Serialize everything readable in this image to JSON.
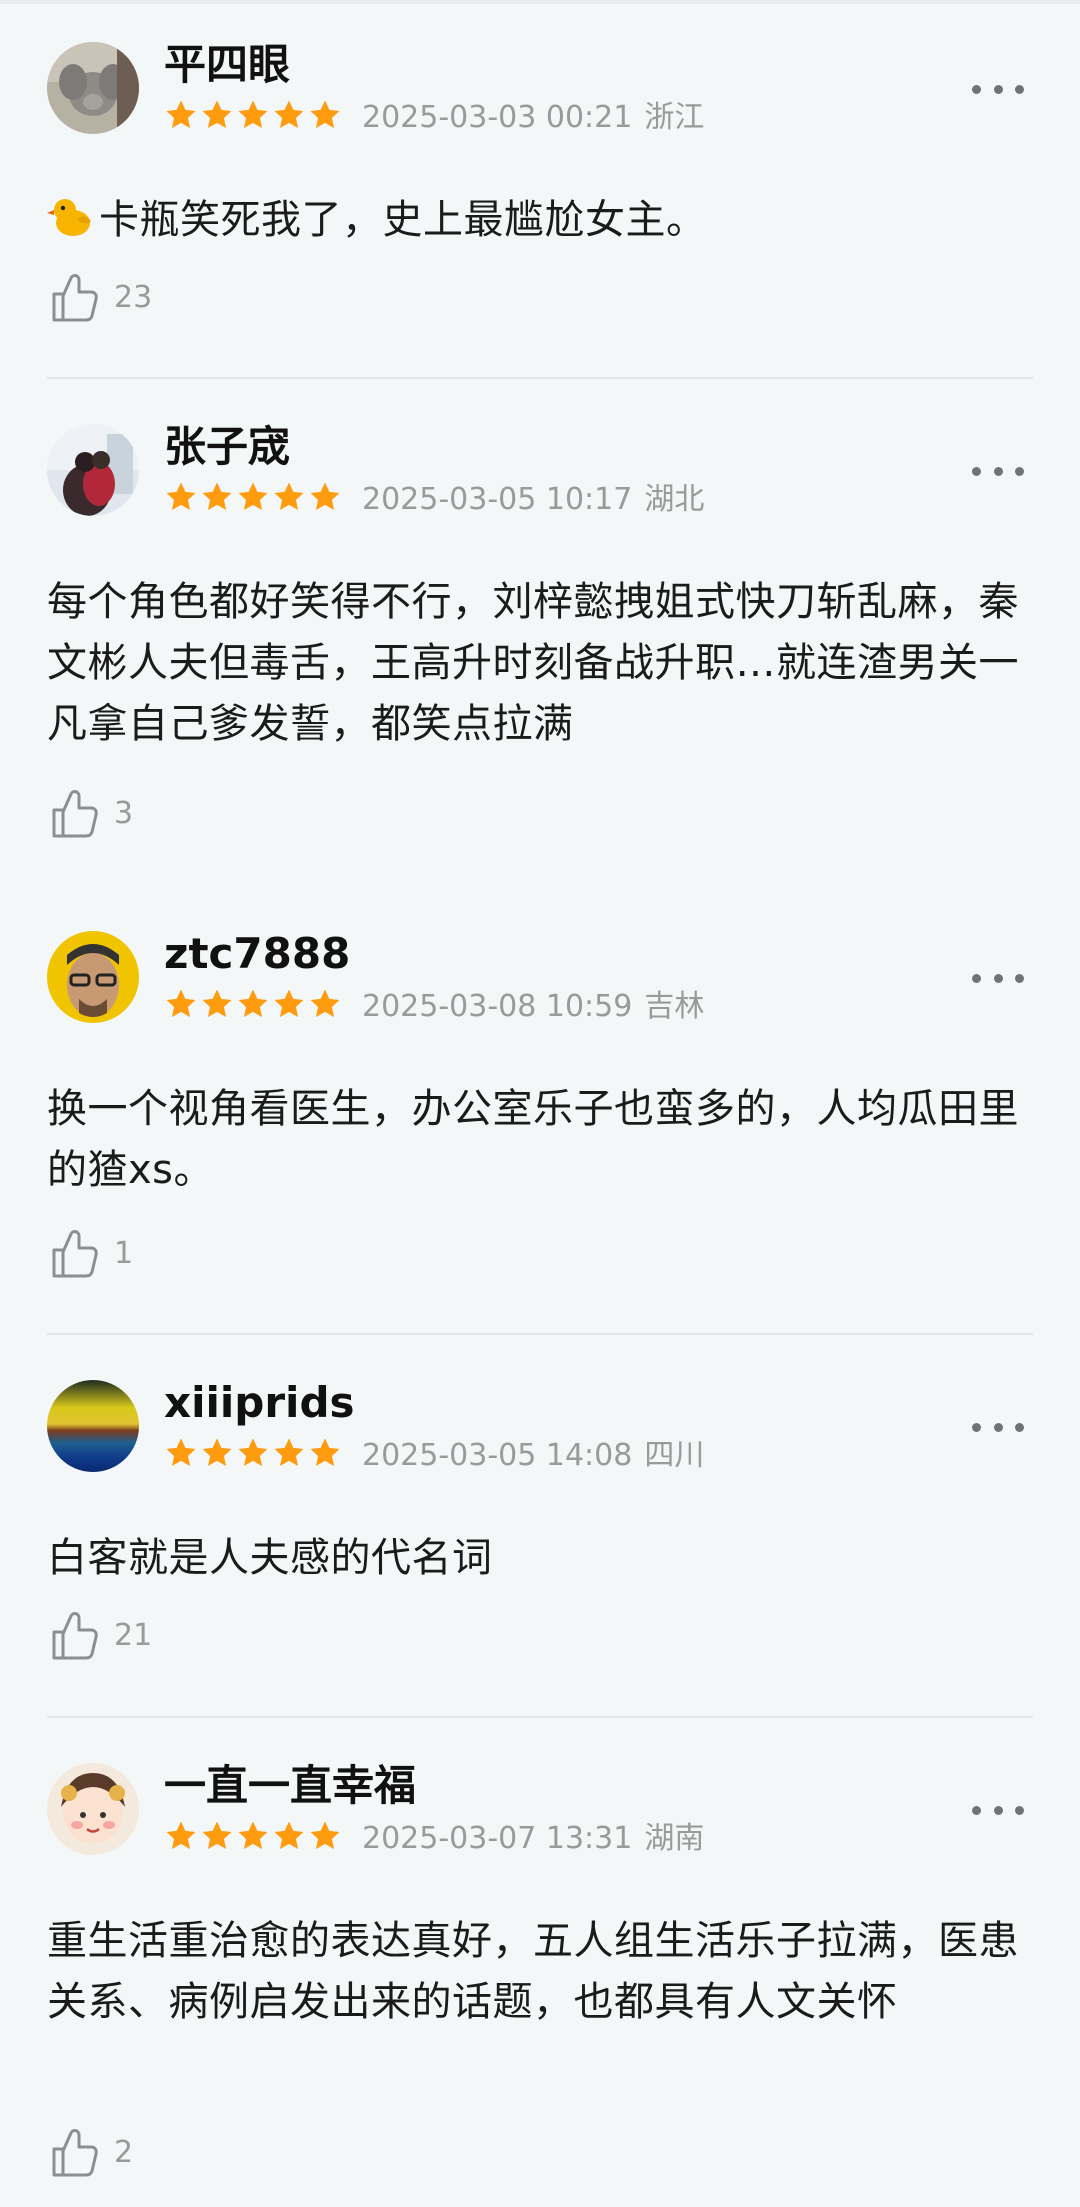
{
  "reviews": [
    {
      "username": "平四眼",
      "rating": 5,
      "date": "2025-03-03 00:21",
      "location": "浙江",
      "content": "卡瓶笑死我了，史上最尴尬女主。",
      "content_prefix_icon": "chick-emoji-icon",
      "likes": "23"
    },
    {
      "username": "张子宬",
      "rating": 5,
      "date": "2025-03-05 10:17",
      "location": "湖北",
      "content": "每个角色都好笑得不行，刘梓懿拽姐式快刀斩乱麻，秦文彬人夫但毒舌，王高升时刻备战升职…就连渣男关一凡拿自己爹发誓，都笑点拉满",
      "likes": "3"
    },
    {
      "username": "ztc7888",
      "rating": 5,
      "date": "2025-03-08 10:59",
      "location": "吉林",
      "content": "换一个视角看医生，办公室乐子也蛮多的，人均瓜田里的猹xs。",
      "likes": "1"
    },
    {
      "username": "xiiiprids",
      "rating": 5,
      "date": "2025-03-05 14:08",
      "location": "四川",
      "content": "白客就是人夫感的代名词",
      "likes": "21"
    },
    {
      "username": "一直一直幸福",
      "rating": 5,
      "date": "2025-03-07 13:31",
      "location": "湖南",
      "content": "重生活重治愈的表达真好，五人组生活乐子拉满，医患关系、病例启发出来的话题，也都具有人文关怀",
      "likes": "2"
    }
  ],
  "colors": {
    "background": "#f4f7f7",
    "star": "#ff9b0f",
    "meta_text": "#9a9a9a",
    "divider": "#e3e6e6"
  },
  "icons": {
    "star": "star-icon",
    "like": "thumbs-up-icon",
    "more": "more-options-icon"
  }
}
